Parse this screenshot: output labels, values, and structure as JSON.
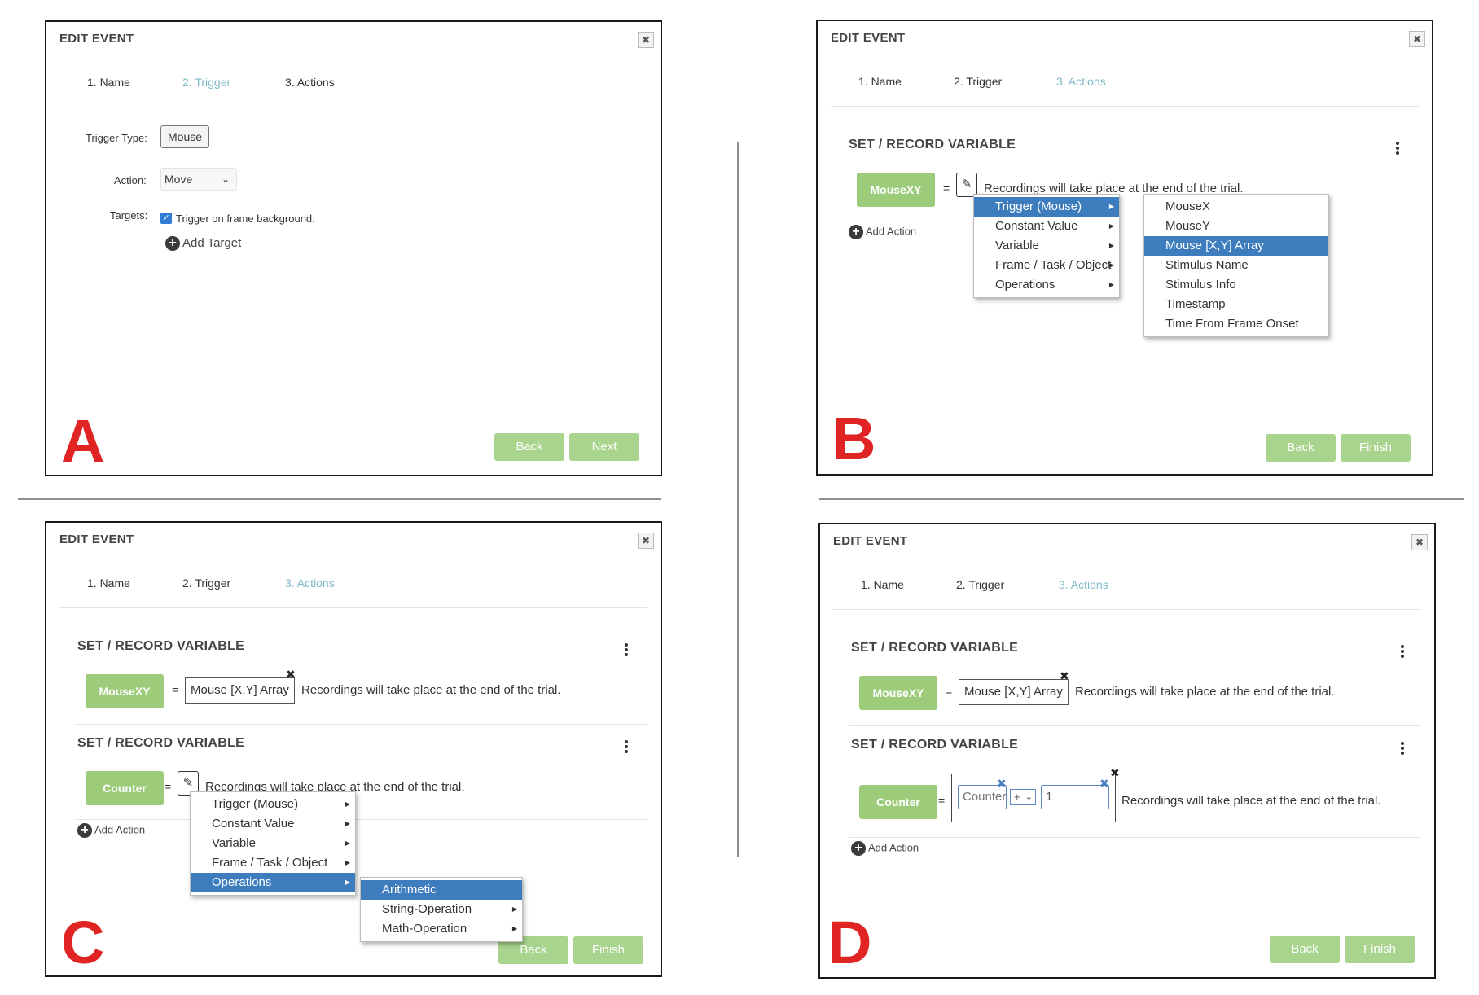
{
  "dialog_title": "EDIT EVENT",
  "close_symbol": "✖",
  "tabs": [
    "1. Name",
    "2. Trigger",
    "3. Actions"
  ],
  "panel_letters": [
    "A",
    "B",
    "C",
    "D"
  ],
  "buttons": {
    "back": "Back",
    "next": "Next",
    "finish": "Finish"
  },
  "panel_a": {
    "trigger_type_label": "Trigger Type:",
    "trigger_type_value": "Mouse",
    "action_label": "Action:",
    "action_value": "Move",
    "targets_label": "Targets:",
    "checkbox_label": "Trigger on frame background.",
    "add_target": "Add Target"
  },
  "section_title": "SET / RECORD VARIABLE",
  "note": "Recordings will take place at the end of the trial.",
  "add_action": "Add Action",
  "var_mousexy": "MouseXY",
  "var_counter": "Counter",
  "value_mouse_array": "Mouse [X,Y] Array",
  "equals": "=",
  "menu_main": [
    "Trigger (Mouse)",
    "Constant Value",
    "Variable",
    "Frame / Task / Object",
    "Operations"
  ],
  "menu_mouse": [
    "MouseX",
    "MouseY",
    "Mouse [X,Y] Array",
    "Stimulus Name",
    "Stimulus Info",
    "Timestamp",
    "Time From Frame Onset"
  ],
  "menu_operations": [
    "Arithmetic",
    "String-Operation",
    "Math-Operation"
  ],
  "panel_d": {
    "counter_placeholder": "Counter",
    "operator": "+",
    "operand": "1"
  }
}
